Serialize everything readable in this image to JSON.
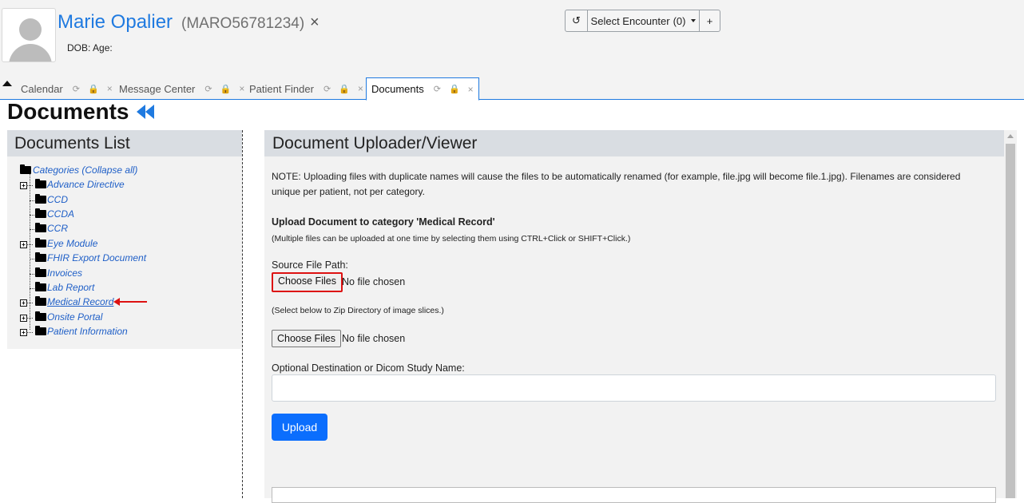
{
  "patient": {
    "name": "Marie Opalier",
    "id": "(MARO56781234)",
    "close_glyph": "×",
    "dob_age": "DOB: Age:"
  },
  "encounter": {
    "history_icon": "↺",
    "select_label": "Select Encounter",
    "count": "(0)",
    "add_glyph": "+"
  },
  "tabs": [
    {
      "label": "Calendar",
      "active": false
    },
    {
      "label": "Message Center",
      "active": false
    },
    {
      "label": "Patient Finder",
      "active": false
    },
    {
      "label": "Documents",
      "active": true
    }
  ],
  "tab_icons": {
    "refresh": "⟳",
    "lock": "🔒",
    "close": "×"
  },
  "page": {
    "title": "Documents"
  },
  "documents_list": {
    "heading": "Documents List",
    "root": "Categories (Collapse all)",
    "categories": [
      {
        "label": "Advance Directive",
        "expandable": true
      },
      {
        "label": "CCD",
        "expandable": false
      },
      {
        "label": "CCDA",
        "expandable": false
      },
      {
        "label": "CCR",
        "expandable": false
      },
      {
        "label": "Eye Module",
        "expandable": true
      },
      {
        "label": "FHIR Export Document",
        "expandable": false
      },
      {
        "label": "Invoices",
        "expandable": false
      },
      {
        "label": "Lab Report",
        "expandable": false
      },
      {
        "label": "Medical Record",
        "expandable": true,
        "selected": true
      },
      {
        "label": "Onsite Portal",
        "expandable": true
      },
      {
        "label": "Patient Information",
        "expandable": true
      }
    ]
  },
  "uploader": {
    "heading": "Document Uploader/Viewer",
    "note": "NOTE: Uploading files with duplicate names will cause the files to be automatically renamed (for example, file.jpg will become file.1.jpg). Filenames are considered unique per patient, not per category.",
    "upload_title": "Upload Document to category 'Medical Record'",
    "multi_hint": "(Multiple files can be uploaded at one time by selecting them using CTRL+Click or SHIFT+Click.)",
    "source_label": "Source File Path:",
    "choose_files": "Choose Files",
    "no_file": "No file chosen",
    "zip_hint": "(Select below to Zip Directory of image slices.)",
    "choose_files_2": "Choose Files",
    "no_file_2": "No file chosen",
    "dest_label": "Optional Destination or Dicom Study Name:",
    "upload_button": "Upload"
  },
  "colors": {
    "accent": "#1f7ae0",
    "upload_btn": "#0b6efd",
    "highlight": "#dd1111"
  }
}
